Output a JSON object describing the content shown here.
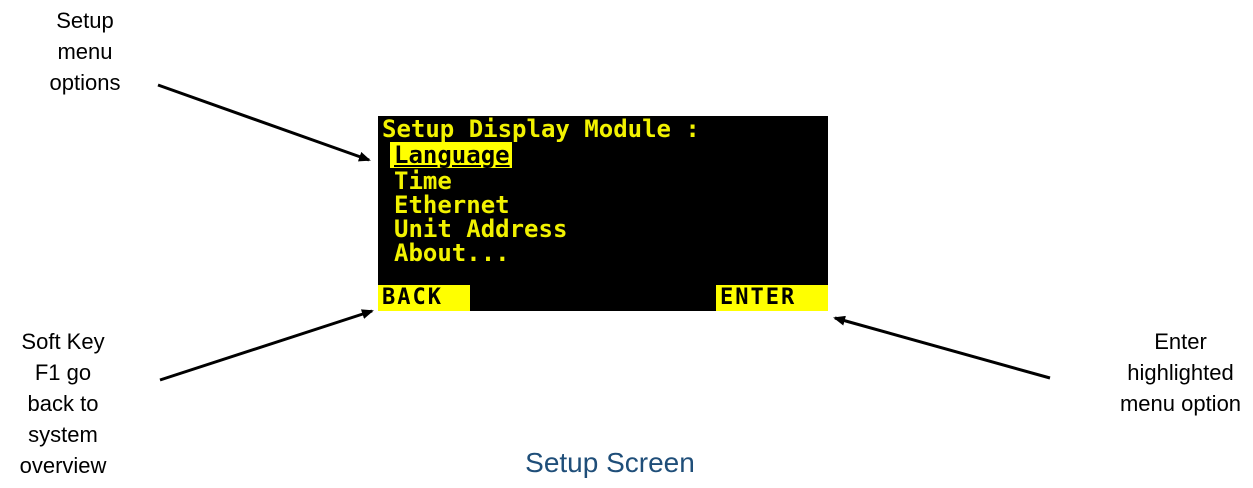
{
  "annotations": {
    "setup_menu": [
      "Setup",
      "menu",
      "options"
    ],
    "soft_key_f1": [
      "Soft Key",
      "F1 go",
      "back to",
      "system",
      "overview"
    ],
    "enter_option": [
      "Enter",
      "highlighted",
      "menu option"
    ]
  },
  "display": {
    "title": "Setup Display Module :",
    "menu_items": [
      "Language",
      "Time",
      "Ethernet",
      "Unit Address",
      "About..."
    ],
    "highlighted_item": "Language",
    "softkeys": {
      "f1": "BACK",
      "f2": "ENTER"
    }
  },
  "caption": "Setup Screen",
  "colors": {
    "lcd_background": "#000000",
    "lcd_text": "#f2f200",
    "highlight": "#ffff00",
    "caption": "#1f4e79"
  }
}
